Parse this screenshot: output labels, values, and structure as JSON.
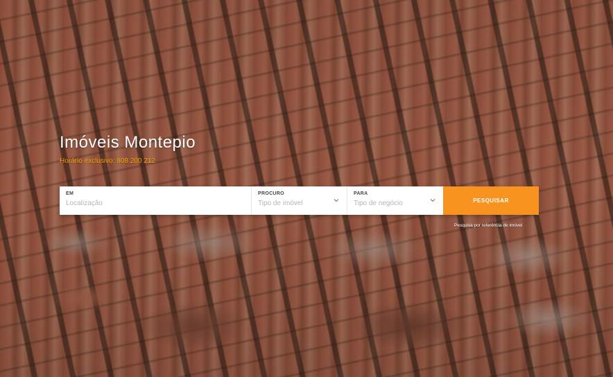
{
  "brand": {
    "title": "Imóveis Montepio",
    "subtitle": "Horário exclusivo: 808 200 212"
  },
  "search": {
    "location_label": "EM",
    "location_placeholder": "Localização",
    "type_label": "PROCURO",
    "type_value": "Tipo de imóvel",
    "deal_label": "PARA",
    "deal_value": "Tipo de negócio",
    "button_label": "PESQUISAR",
    "reference_link": "Pesquisa por referência de imóvel"
  },
  "colors": {
    "accent": "#f7931e",
    "subtitle": "#f5a000"
  },
  "icons": {
    "type_dropdown": "chevron-down-icon",
    "deal_dropdown": "chevron-down-icon"
  }
}
